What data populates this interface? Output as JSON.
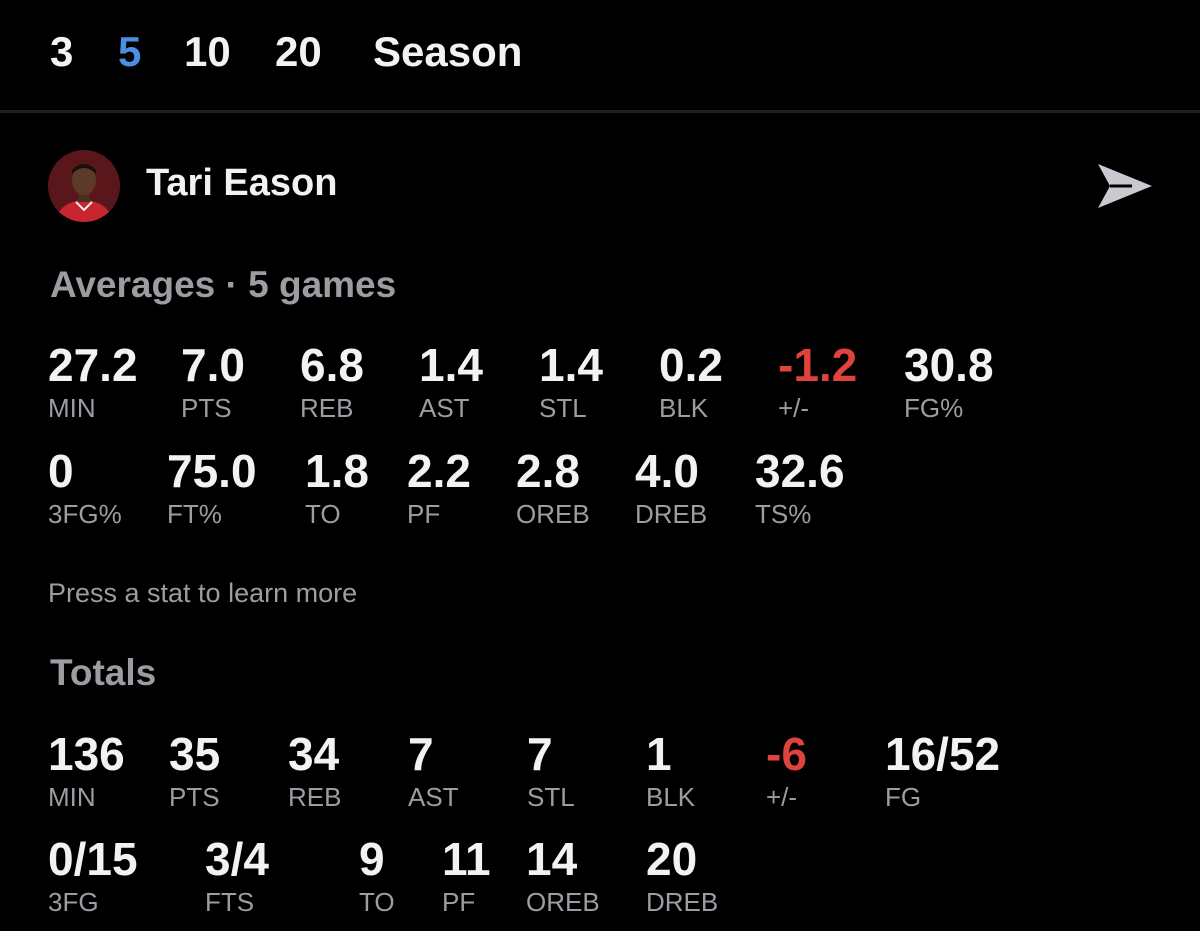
{
  "tabs": [
    {
      "label": "3",
      "active": false
    },
    {
      "label": "5",
      "active": true
    },
    {
      "label": "10",
      "active": false
    },
    {
      "label": "20",
      "active": false
    },
    {
      "label": "Season",
      "active": false
    }
  ],
  "colors": {
    "accent": "#4a90e2",
    "negative": "#e0433d",
    "muted": "#9c9ca3",
    "background": "#000000"
  },
  "player": {
    "name": "Tari Eason",
    "avatar_icon": "player-headshot",
    "share_icon": "send-icon"
  },
  "averages": {
    "title": "Averages · 5 games",
    "row1": [
      {
        "value": "27.2",
        "label": "MIN"
      },
      {
        "value": "7.0",
        "label": "PTS"
      },
      {
        "value": "6.8",
        "label": "REB"
      },
      {
        "value": "1.4",
        "label": "AST"
      },
      {
        "value": "1.4",
        "label": "STL"
      },
      {
        "value": "0.2",
        "label": "BLK"
      },
      {
        "value": "-1.2",
        "label": "+/-"
      },
      {
        "value": "30.8",
        "label": "FG%"
      }
    ],
    "row2": [
      {
        "value": "0",
        "label": "3FG%"
      },
      {
        "value": "75.0",
        "label": "FT%"
      },
      {
        "value": "1.8",
        "label": "TO"
      },
      {
        "value": "2.2",
        "label": "PF"
      },
      {
        "value": "2.8",
        "label": "OREB"
      },
      {
        "value": "4.0",
        "label": "DREB"
      },
      {
        "value": "32.6",
        "label": "TS%"
      }
    ]
  },
  "hint": "Press a stat to learn more",
  "totals": {
    "title": "Totals",
    "row1": [
      {
        "value": "136",
        "label": "MIN"
      },
      {
        "value": "35",
        "label": "PTS"
      },
      {
        "value": "34",
        "label": "REB"
      },
      {
        "value": "7",
        "label": "AST"
      },
      {
        "value": "7",
        "label": "STL"
      },
      {
        "value": "1",
        "label": "BLK"
      },
      {
        "value": "-6",
        "label": "+/-"
      },
      {
        "value": "16/52",
        "label": "FG"
      }
    ],
    "row2": [
      {
        "value": "0/15",
        "label": "3FG"
      },
      {
        "value": "3/4",
        "label": "FTS"
      },
      {
        "value": "9",
        "label": "TO"
      },
      {
        "value": "11",
        "label": "PF"
      },
      {
        "value": "14",
        "label": "OREB"
      },
      {
        "value": "20",
        "label": "DREB"
      }
    ]
  }
}
